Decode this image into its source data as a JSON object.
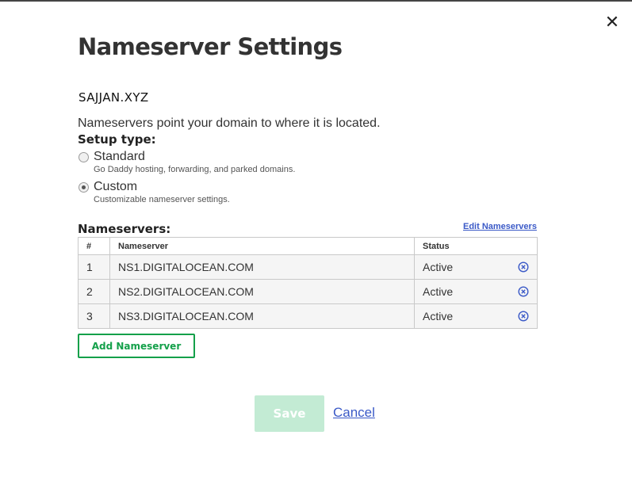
{
  "dialog": {
    "title": "Nameserver Settings",
    "close_icon": "close-icon",
    "domain": "SAJJAN.XYZ",
    "description": "Nameservers point your domain to where it is located.",
    "setup_type_label": "Setup type:",
    "setup_options": [
      {
        "label": "Standard",
        "sublabel": "Go Daddy hosting, forwarding, and parked domains.",
        "checked": false
      },
      {
        "label": "Custom",
        "sublabel": "Customizable nameserver settings.",
        "checked": true
      }
    ],
    "nameservers_heading": "Nameservers:",
    "edit_link": "Edit Nameservers",
    "table": {
      "headers": [
        "#",
        "Nameserver",
        "Status"
      ],
      "rows": [
        {
          "num": "1",
          "nameserver": "NS1.DIGITALOCEAN.COM",
          "status": "Active"
        },
        {
          "num": "2",
          "nameserver": "NS2.DIGITALOCEAN.COM",
          "status": "Active"
        },
        {
          "num": "3",
          "nameserver": "NS3.DIGITALOCEAN.COM",
          "status": "Active"
        }
      ]
    },
    "add_button": "Add Nameserver",
    "save_button": "Save",
    "cancel_link": "Cancel"
  },
  "colors": {
    "accent_green": "#14a04a",
    "save_disabled": "#c3ebd4",
    "link_blue": "#3a59c7"
  }
}
